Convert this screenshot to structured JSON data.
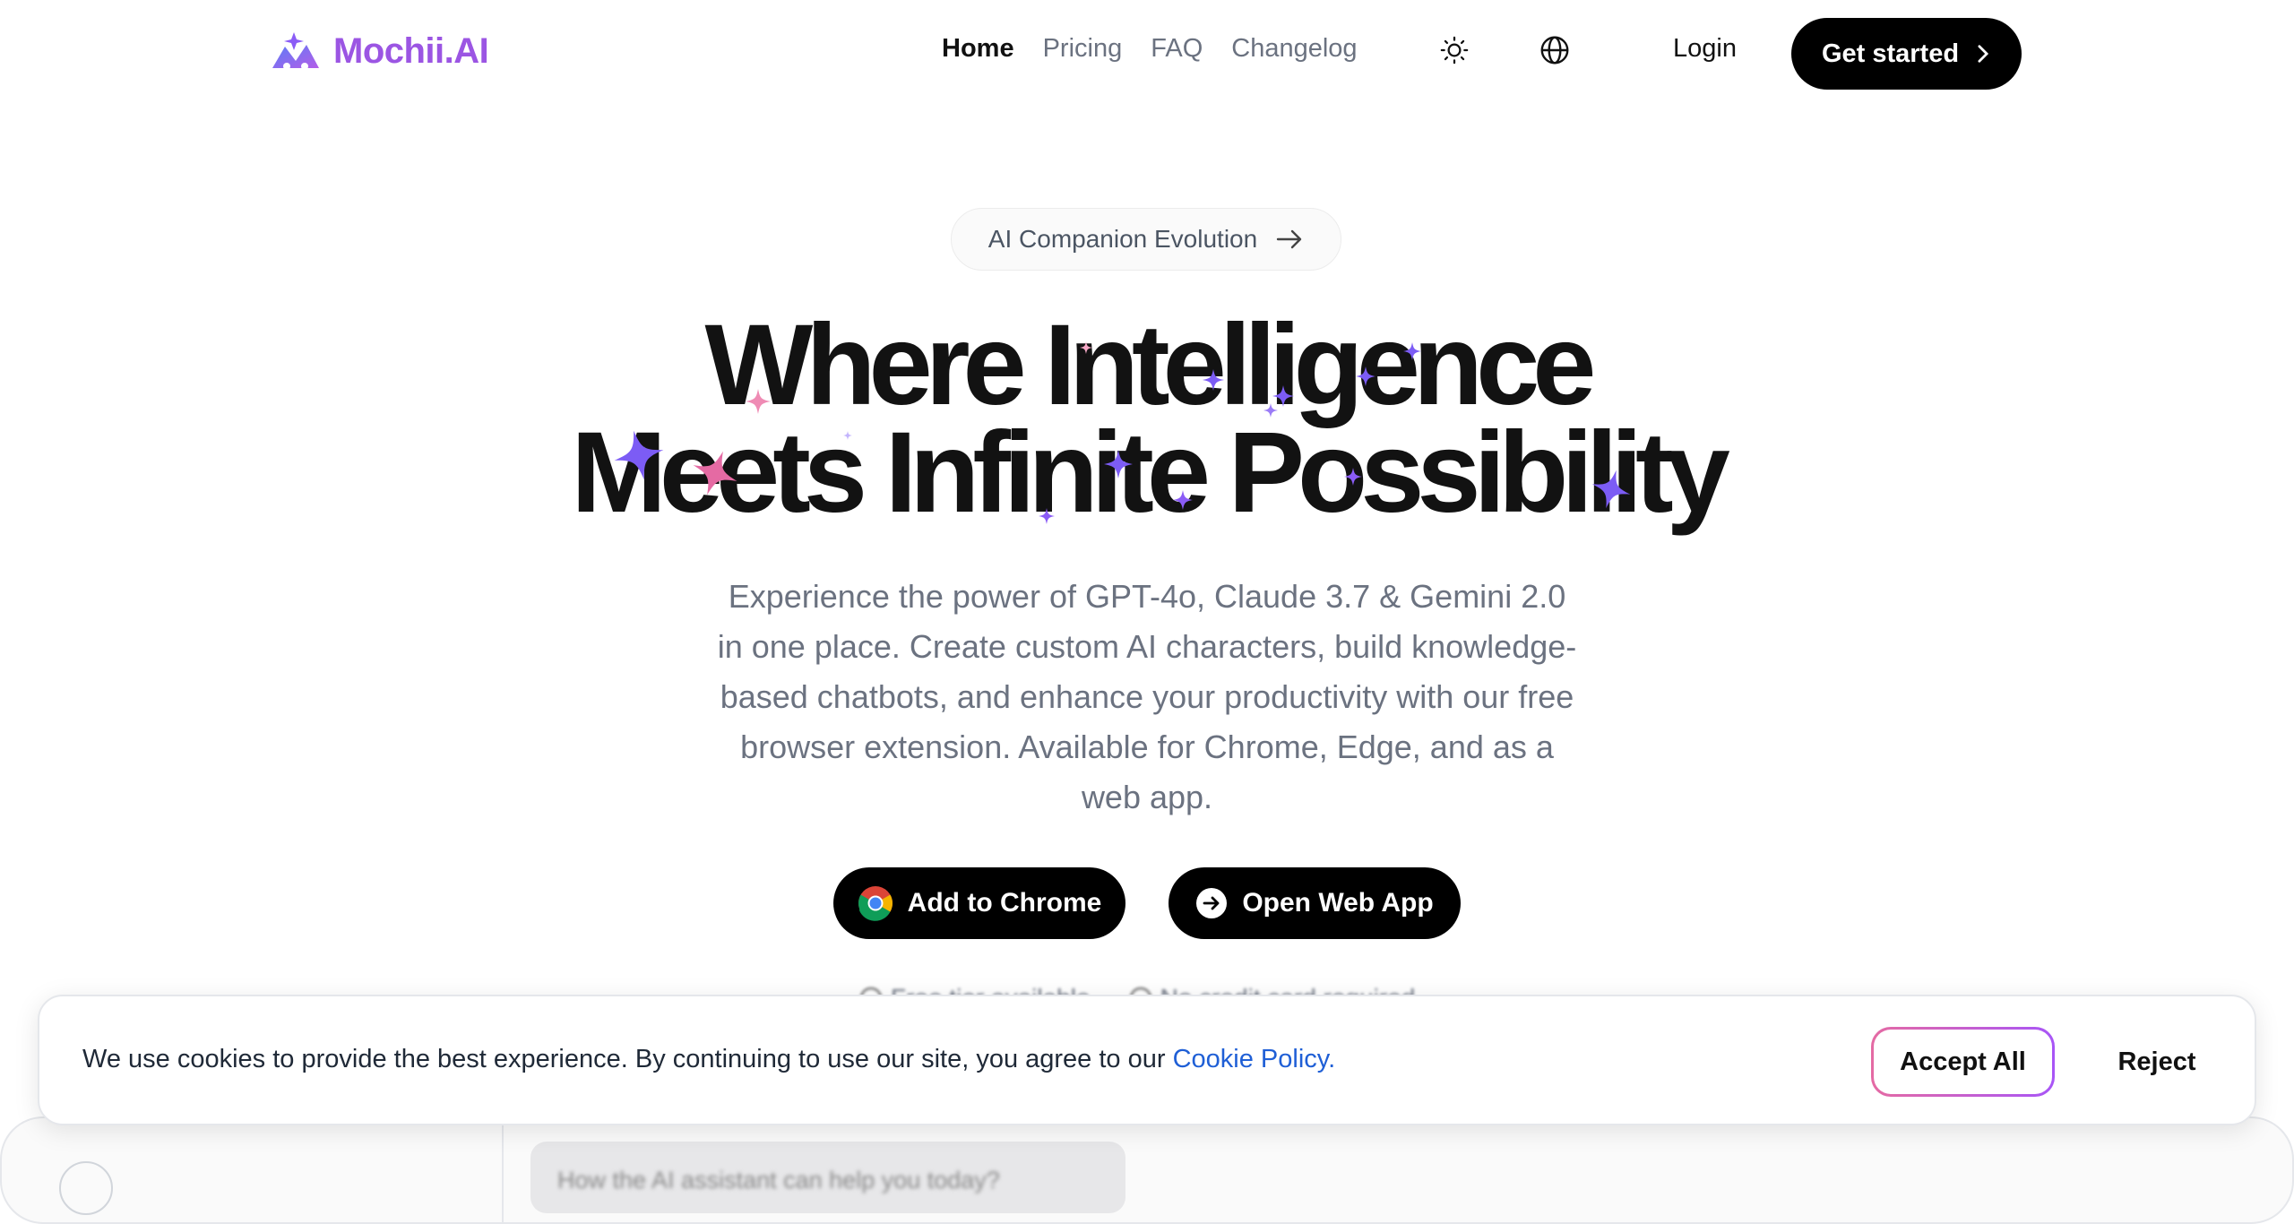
{
  "header": {
    "brand": "Mochii.AI",
    "nav": [
      {
        "label": "Home",
        "active": true
      },
      {
        "label": "Pricing",
        "active": false
      },
      {
        "label": "FAQ",
        "active": false
      },
      {
        "label": "Changelog",
        "active": false
      }
    ],
    "theme_icon": "sun-icon",
    "language_icon": "globe-icon",
    "login_label": "Login",
    "cta_label": "Get started",
    "brand_color": "#9b55e3"
  },
  "hero": {
    "badge": "AI Companion Evolution",
    "headline_line1": "Where Intelligence",
    "headline_line2": "Meets Infinite Possibility",
    "subtitle": "Experience the power of GPT-4o, Claude 3.7 & Gemini 2.0 in one place. Create custom AI characters, build knowledge-based chatbots, and enhance your productivity with our free browser extension. Available for Chrome, Edge, and as a web app.",
    "add_to_chrome": "Add to Chrome",
    "open_web_app": "Open Web App",
    "features": [
      "Free tier available",
      "No credit card required"
    ],
    "sparkle_colors": [
      "#7c5cf5",
      "#e56aa3",
      "#9b55e3"
    ]
  },
  "preview": {
    "bubble_text": "How the AI assistant can help you today?"
  },
  "cookie": {
    "message": "We use cookies to provide the best experience. By continuing to use our site, you agree to our",
    "link_text": "Cookie Policy.",
    "accept": "Accept All",
    "reject": "Reject"
  }
}
